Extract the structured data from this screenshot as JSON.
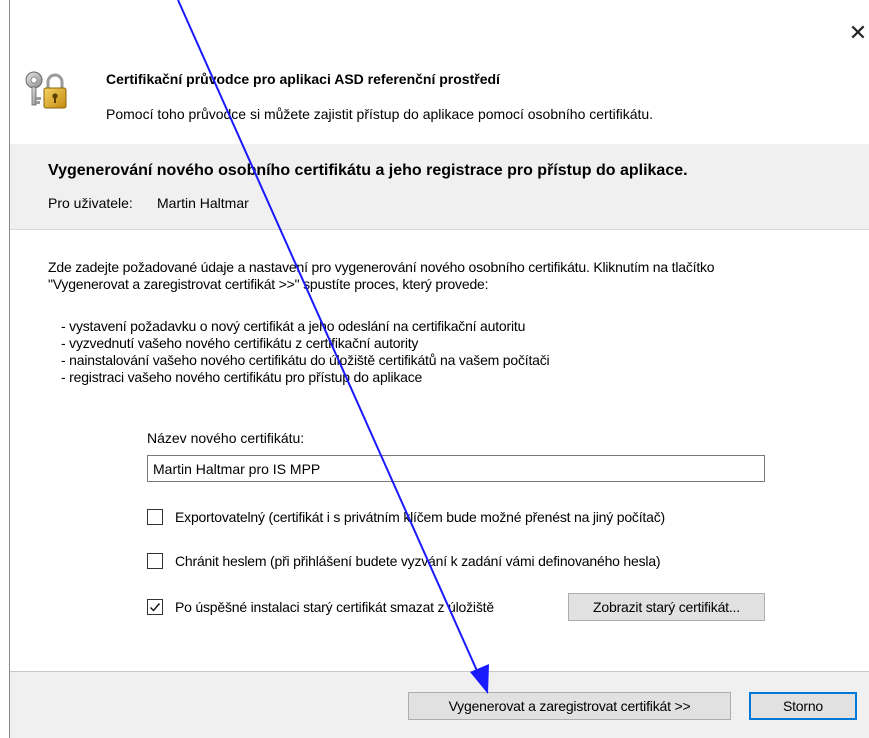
{
  "header": {
    "title": "Certifikační průvodce pro aplikaci ASD referenční prostředí",
    "subtitle": "Pomocí toho průvodce si můžete zajistit přístup do aplikace pomocí osobního certifikátu.",
    "icon": "keys-lock-icon",
    "close_glyph": "✕"
  },
  "section": {
    "title": "Vygenerování nového osobního certifikátu a jeho registrace pro přístup do aplikace.",
    "user_label": "Pro uživatele:",
    "user_value": "Martin Haltmar"
  },
  "body": {
    "intro_line1": "Zde zadejte požadované údaje a nastavení pro vygenerování nového osobního certifikátu. Kliknutím na tlačítko",
    "intro_line2": "\"Vygenerovat a zaregistrovat certifikát >>\" spustíte proces, který provede:",
    "bullets": [
      "- vystavení požadavku o nový certifikát a jeho odeslání na certifikační autoritu",
      "- vyzvednutí vašeho nového certifikátu z certifikační autority",
      "- nainstalování vašeho nového certifikátu do úložiště certifikátů na vašem počítači",
      "- registraci vašeho nového certifikátu pro přístup do aplikace"
    ]
  },
  "form": {
    "name_label": "Název nového certifikátu:",
    "name_value": "Martin Haltmar pro IS MPP",
    "checkboxes": [
      {
        "label": "Exportovatelný (certifikát i s privátním klíčem bude možné přenést na jiný počítač)",
        "checked": false
      },
      {
        "label": "Chránit heslem (při přihlášení budete vyzvání k zadání vámi definovaného hesla)",
        "checked": false
      },
      {
        "label": "Po úspěšné instalaci starý certifikát smazat z úložiště",
        "checked": true
      }
    ],
    "show_old_button": "Zobrazit starý certifikát..."
  },
  "footer": {
    "generate_button": "Vygenerovat a zaregistrovat certifikát >>",
    "cancel_button": "Storno"
  },
  "colors": {
    "annotation_arrow": "#1a1aff",
    "panel_bg": "#f0f0f0",
    "button_bg": "#e1e1e1",
    "default_button_border": "#0078d7"
  }
}
